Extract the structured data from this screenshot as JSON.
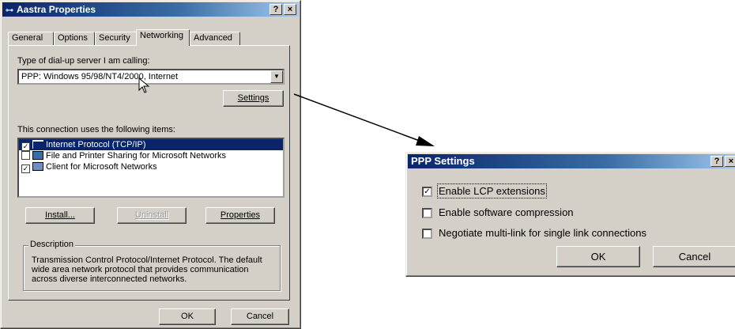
{
  "aastra": {
    "title": "Aastra Properties",
    "help_btn": "?",
    "close_btn": "×",
    "tabs": [
      "General",
      "Options",
      "Security",
      "Networking",
      "Advanced"
    ],
    "active_tab": "Networking",
    "server_label": "Type of dial-up server I am calling:",
    "server_value": "PPP: Windows 95/98/NT4/2000, Internet",
    "settings_btn": "Settings",
    "items_label": "This connection uses the following items:",
    "items": [
      {
        "label": "Internet Protocol (TCP/IP)",
        "checked": true,
        "selected": true
      },
      {
        "label": "File and Printer Sharing for Microsoft Networks",
        "checked": false,
        "selected": false
      },
      {
        "label": "Client for Microsoft Networks",
        "checked": true,
        "selected": false
      }
    ],
    "install_btn": "Install...",
    "uninstall_btn": "Uninstall",
    "properties_btn": "Properties",
    "description_legend": "Description",
    "description_text": "Transmission Control Protocol/Internet Protocol. The default wide area network protocol that provides communication across diverse interconnected networks.",
    "ok_btn": "OK",
    "cancel_btn": "Cancel"
  },
  "ppp": {
    "title": "PPP Settings",
    "help_btn": "?",
    "close_btn": "×",
    "options": [
      {
        "label": "Enable LCP extensions",
        "checked": true
      },
      {
        "label": "Enable software compression",
        "checked": false
      },
      {
        "label": "Negotiate multi-link for single link connections",
        "checked": false
      }
    ],
    "ok_btn": "OK",
    "cancel_btn": "Cancel"
  },
  "colors": {
    "titlebar_start": "#0a246a",
    "titlebar_end": "#a6caf0",
    "dialog_face": "#d4d0c8",
    "selection": "#0a246a"
  }
}
